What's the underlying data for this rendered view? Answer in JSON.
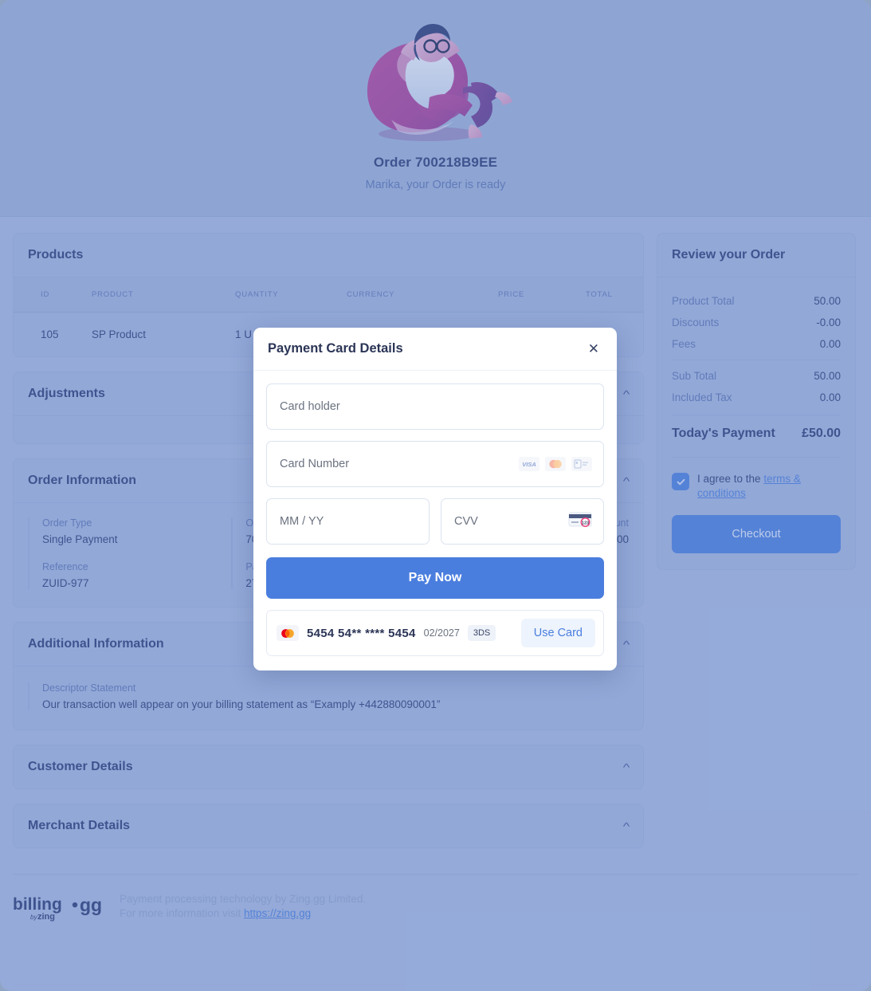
{
  "hero": {
    "illustration_name": "person-relaxing-in-beanbag-illustration",
    "title": "Order 700218B9EE",
    "subtitle": "Marika, your Order is ready"
  },
  "products": {
    "section_title": "Products",
    "columns": [
      "ID",
      "PRODUCT",
      "QUANTITY",
      "CURRENCY",
      "PRICE",
      "TOTAL"
    ],
    "rows": [
      {
        "id": "105",
        "product": "SP Product",
        "quantity": "1 U",
        "currency": "",
        "price": "",
        "total": ""
      }
    ]
  },
  "adjustments": {
    "section_title": "Adjustments",
    "collapse_icon": "chevron-up-icon"
  },
  "order_information": {
    "section_title": "Order Information",
    "collapse_icon": "chevron-up-icon",
    "fields": [
      {
        "label": "Order Type",
        "value": "Single Payment"
      },
      {
        "label": "Reference",
        "value": "ZUID-977"
      },
      {
        "label": "Or",
        "value": "70"
      },
      {
        "label": "Pa",
        "value": "27"
      },
      {
        "label": "unt",
        "value": "00"
      }
    ]
  },
  "additional_information": {
    "section_title": "Additional Information",
    "collapse_icon": "chevron-up-icon",
    "descriptor_label": "Descriptor Statement",
    "descriptor_text": "Our transaction well appear on your billing statement as “Examply +442880090001”"
  },
  "customer_details": {
    "section_title": "Customer Details",
    "collapse_icon": "chevron-up-icon"
  },
  "merchant_details": {
    "section_title": "Merchant Details",
    "collapse_icon": "chevron-up-icon"
  },
  "summary": {
    "title": "Review your Order",
    "rows": [
      {
        "label": "Product Total",
        "value": "50.00"
      },
      {
        "label": "Discounts",
        "value": "-0.00"
      },
      {
        "label": "Fees",
        "value": "0.00"
      },
      {
        "label": "Sub Total",
        "value": "50.00"
      },
      {
        "label": "Included Tax",
        "value": "0.00"
      }
    ],
    "total_label": "Today's Payment",
    "total_value": "£50.00",
    "terms_prefix": "I agree to the ",
    "terms_link": "terms & conditions",
    "checkout_label": "Checkout",
    "checkbox_checked": true
  },
  "footer": {
    "logo_text": "billing·gg",
    "logo_sub": "by zing",
    "line1": "Payment processing technology by Zing.gg Limited.",
    "line2_prefix": "For more information visit ",
    "link": "https://zing.gg"
  },
  "modal": {
    "title": "Payment Card Details",
    "close_icon": "close-icon",
    "card_holder_placeholder": "Card holder",
    "card_number_placeholder": "Card Number",
    "expiry_placeholder": "MM / YY",
    "cvv_placeholder": "CVV",
    "card_brands": [
      "visa-icon",
      "mastercard-icon",
      "generic-card-icon"
    ],
    "cvv_icon": "card-back-cvv-icon",
    "pay_label": "Pay Now",
    "saved_card": {
      "brand_icon": "mastercard-icon",
      "number": "5454 54** **** 5454",
      "expiry": "02/2027",
      "badge": "3DS",
      "use_card_label": "Use Card"
    }
  },
  "colors": {
    "accent": "#4a7ede",
    "page_bg": "#a7b8e0",
    "hero_bg": "#9cb0d8",
    "heading": "#2c3c77",
    "muted": "#5b74b5"
  }
}
